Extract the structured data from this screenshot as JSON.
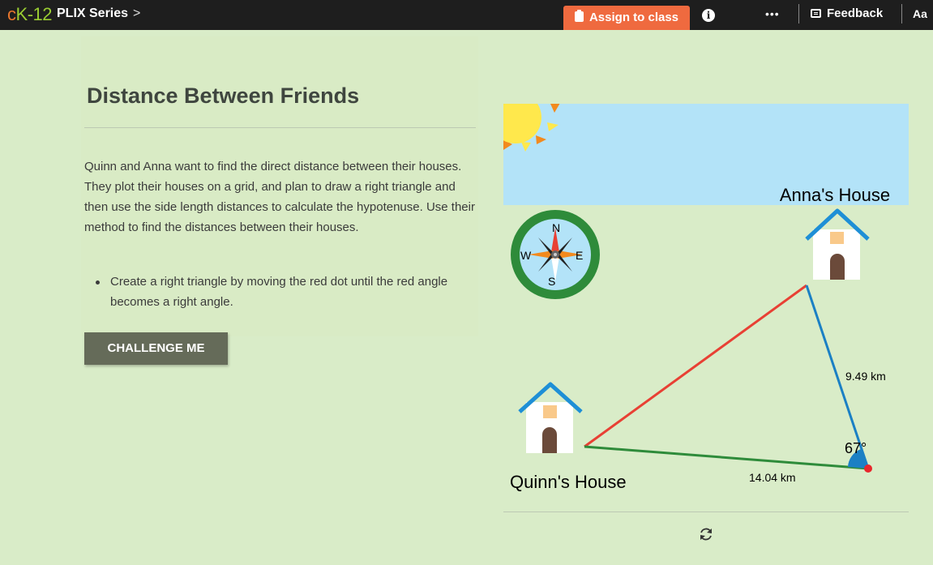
{
  "topbar": {
    "logo_c": "c",
    "logo_k": "K",
    "logo_rest": "-12",
    "series_label": "PLIX Series",
    "chevron": ">",
    "assign_label": "Assign to class",
    "info_label": "i",
    "more_label": "•••",
    "feedback_label": "Feedback",
    "text_size_label": "Aa"
  },
  "content": {
    "title": "Distance Between Friends",
    "intro": "Quinn and Anna want to find the direct distance between their houses. They plot their houses on a grid, and plan to draw a right triangle and then use the side length distances to calculate the hypotenuse. Use their method to find the distances between their houses.",
    "bullet": "Create a right triangle by moving the red dot until the red angle becomes a right angle.",
    "challenge_label": "CHALLENGE ME"
  },
  "interactive": {
    "anna_label": "Anna's House",
    "quinn_label": "Quinn's House",
    "side_blue_label": "9.49 km",
    "side_green_label": "14.04 km",
    "angle_label": "67°",
    "compass": {
      "n": "N",
      "s": "S",
      "e": "E",
      "w": "W"
    },
    "colors": {
      "sky": "#b3e3f8",
      "sun": "#ffe84c",
      "hypotenuse": "#e84034",
      "blue_side": "#1b80c4",
      "green_side": "#2e8b3a",
      "drag_dot": "#e8262b",
      "compass_ring": "#2e8b3a",
      "roof": "#1e8fd6"
    }
  }
}
